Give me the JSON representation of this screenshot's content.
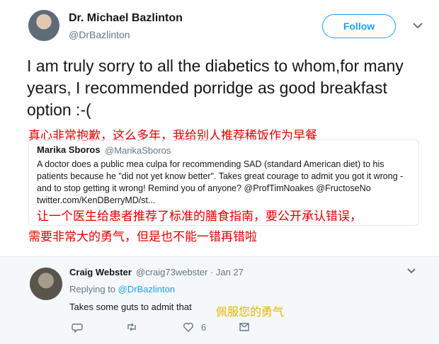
{
  "author": {
    "name": "Dr. Michael Bazlinton",
    "handle": "@DrBazlinton",
    "follow_label": "Follow"
  },
  "tweet": {
    "text": "I am truly sorry to all the diabetics to whom,for many years, I recommended porridge as good breakfast option :-("
  },
  "annotations": {
    "a1": "真心非常抱歉，这么多年，我给别人推荐稀饭作为早餐",
    "a2": "让一个医生给患者推荐了标准的膳食指南，要公开承认错误，",
    "a3": "需要非常大的勇气，但是也不能一错再错啦",
    "a4": "佩服您的勇气"
  },
  "quoted": {
    "name": "Marika Sboros",
    "handle": "@MarikaSboros",
    "text": "A doctor does a public mea culpa for recommending SAD (standard American diet) to his patients because he \"did not yet know better\". Takes great courage to admit you got it wrong - and to stop getting it wrong! Remind you of anyone? @ProfTimNoakes @FructoseNo twitter.com/KenDBerryMD/st..."
  },
  "reply": {
    "name": "Craig Webster",
    "handle_time": "@craig73webster · Jan 27",
    "replying_prefix": "Replying to ",
    "replying_to": "@DrBazlinton",
    "text": "Takes some guts to admit that",
    "like_count": "6"
  },
  "icons": [
    "chevron-down-icon",
    "reply-icon",
    "retweet-icon",
    "like-icon",
    "message-icon"
  ],
  "colors": {
    "accent": "#1da1f2",
    "annotation_red": "#e00000",
    "annotation_yellow": "#e8b400"
  }
}
